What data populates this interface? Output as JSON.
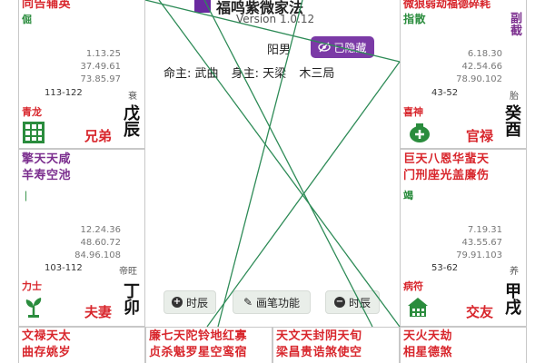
{
  "app": {
    "title": "福鸣紫微家法",
    "version": "Version 1.0.12"
  },
  "chart_info": {
    "gender": "阳男",
    "hide_label": "已隐藏",
    "ming_zhu": "命主: 武曲",
    "shen_zhu": "身主: 天梁",
    "ju": "木三局"
  },
  "toolbar": {
    "prev_label": "时辰",
    "pen_label": "画笔功能",
    "next_label": "时辰"
  },
  "palaces": {
    "top_left": {
      "stars_row1": "同告辅英",
      "stars_row2": "倔",
      "ages": [
        "1.13.25",
        "37.49.61",
        "73.85.97"
      ],
      "range": "113-122",
      "changsheng": "衰",
      "god": "青龙",
      "name": "兄弟",
      "ganzhi": "戊辰"
    },
    "mid_left": {
      "stars_row1": "擎天天咸",
      "stars_row2": "羊寿空池",
      "ages": [
        "12.24.36",
        "48.60.72",
        "84.96.108"
      ],
      "range": "103-112",
      "changsheng": "帝旺",
      "god": "力士",
      "name": "夫妻",
      "ganzhi": "丁卯"
    },
    "top_right": {
      "stars_row1": "微狼弱劫福德碎耗",
      "stars_row2": "指散",
      "extra": "副截",
      "ages": [
        "6.18.30",
        "42.54.66",
        "78.90.102"
      ],
      "range": "43-52",
      "changsheng": "胎",
      "god": "喜神",
      "name": "官禄",
      "ganzhi": "癸酉"
    },
    "mid_right": {
      "stars_row1": "巨天八恩华蜚天",
      "stars_row2": "门刑座光盖廉伤",
      "stars_row3": "竭",
      "ages": [
        "7.19.31",
        "43.55.67",
        "79.91.103"
      ],
      "range": "53-62",
      "changsheng": "养",
      "god": "病符",
      "name": "交友",
      "ganzhi": "甲戌"
    },
    "bottom_left": {
      "stars_row1": "文禄天太",
      "stars_row2": "曲存姚岁"
    },
    "bottom_c1": {
      "stars_row1": "廉七天陀铃地红寡",
      "stars_row2": "贞杀魁罗星空鸾宿"
    },
    "bottom_c2": {
      "stars_row1": "天文天封阴天旬",
      "stars_row2": "梁昌贵诰煞使空"
    },
    "bottom_right": {
      "stars_row1": "天火天劫",
      "stars_row2": "相星德煞"
    }
  },
  "colors": {
    "accent": "#7b3aa6",
    "star_red": "#d8262c",
    "star_purple": "#7b2e8e",
    "line_green": "#2e8b57"
  }
}
